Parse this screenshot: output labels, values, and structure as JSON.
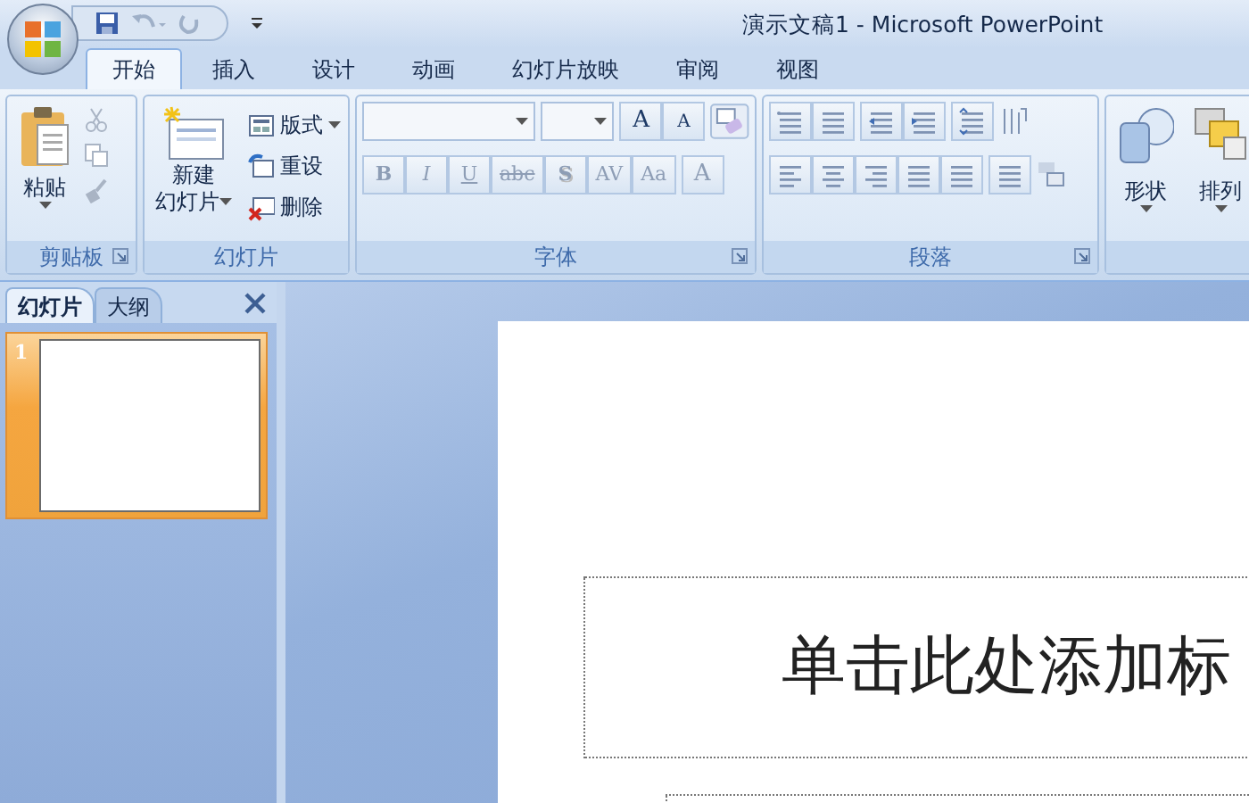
{
  "window": {
    "title": "演示文稿1 - Microsoft PowerPoint"
  },
  "tabs": [
    {
      "label": "开始",
      "selected": true
    },
    {
      "label": "插入",
      "selected": false
    },
    {
      "label": "设计",
      "selected": false
    },
    {
      "label": "动画",
      "selected": false
    },
    {
      "label": "幻灯片放映",
      "selected": false
    },
    {
      "label": "审阅",
      "selected": false
    },
    {
      "label": "视图",
      "selected": false
    }
  ],
  "ribbon": {
    "clipboard": {
      "label": "剪贴板",
      "paste": "粘贴",
      "small_buttons": [
        {
          "kind": "cut",
          "disabled": true
        },
        {
          "kind": "copy",
          "disabled": true
        },
        {
          "kind": "format_painter",
          "disabled": true
        }
      ]
    },
    "slides": {
      "label": "幻灯片",
      "new_slide": [
        "新建",
        "幻灯片"
      ],
      "small_buttons": [
        {
          "kind": "layout",
          "label": "版式"
        },
        {
          "kind": "reset",
          "label": "重设"
        },
        {
          "kind": "delete",
          "label": "删除"
        }
      ]
    },
    "font": {
      "label": "字体",
      "size_buttons": [
        {
          "kind": "grow",
          "text": "A"
        },
        {
          "kind": "shrink",
          "text": "A"
        }
      ],
      "format_buttons": [
        {
          "kind": "bold",
          "text": "B",
          "disabled": true
        },
        {
          "kind": "italic",
          "text": "I",
          "disabled": true
        },
        {
          "kind": "underline",
          "text": "U",
          "disabled": true
        },
        {
          "kind": "strike",
          "text": "abc",
          "disabled": true
        },
        {
          "kind": "shadow",
          "text": "S",
          "disabled": true
        },
        {
          "kind": "spacing",
          "text": "AV",
          "disabled": true
        },
        {
          "kind": "case",
          "text": "Aa",
          "disabled": true
        },
        {
          "kind": "color",
          "text": "A",
          "disabled": true
        }
      ]
    },
    "paragraph": {
      "label": "段落"
    },
    "drawing": {
      "buttons": [
        {
          "kind": "shapes",
          "label": "形状"
        },
        {
          "kind": "arrange",
          "label": "排列"
        }
      ]
    }
  },
  "slide_pane": {
    "tabs": [
      {
        "label": "幻灯片",
        "selected": true
      },
      {
        "label": "大纲",
        "selected": false
      }
    ],
    "thumbnails": [
      {
        "number": "1",
        "selected": true
      }
    ]
  },
  "slide": {
    "title_placeholder": "单击此处添加标"
  }
}
